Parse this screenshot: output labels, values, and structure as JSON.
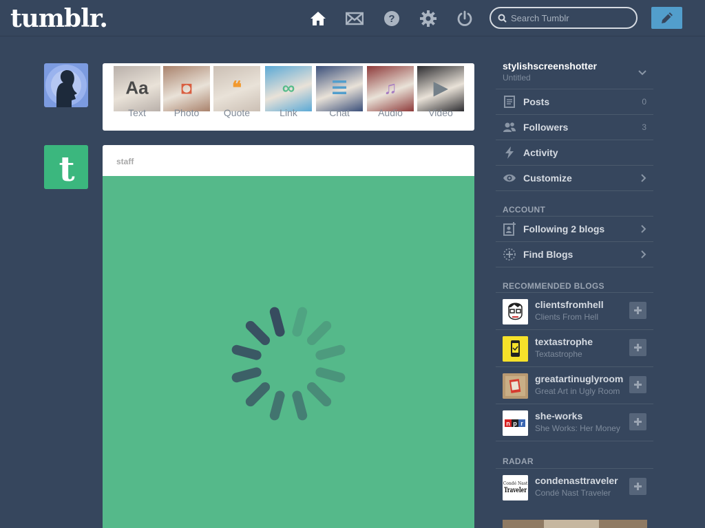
{
  "header": {
    "logo": "tumblr.",
    "search_placeholder": "Search Tumblr",
    "nav_icons": [
      "home-icon",
      "mail-icon",
      "help-icon",
      "gear-icon",
      "power-icon"
    ],
    "compose_icon": "pencil-icon"
  },
  "post_types": [
    {
      "label": "Text",
      "glyph": "Aa",
      "color": "#4a4a4a"
    },
    {
      "label": "Photo",
      "glyph": "◘",
      "color": "#d95e40"
    },
    {
      "label": "Quote",
      "glyph": "❝",
      "color": "#f2992e"
    },
    {
      "label": "Link",
      "glyph": "∞",
      "color": "#56bc8a"
    },
    {
      "label": "Chat",
      "glyph": "☰",
      "color": "#529ecc"
    },
    {
      "label": "Audio",
      "glyph": "♫",
      "color": "#a77dc2"
    },
    {
      "label": "Video",
      "glyph": "▶",
      "color": "#748089"
    }
  ],
  "post": {
    "author": "staff"
  },
  "sidebar": {
    "blog_name": "stylishscreenshotter",
    "blog_subtitle": "Untitled",
    "items": [
      {
        "label": "Posts",
        "count": "0",
        "icon": "posts-icon"
      },
      {
        "label": "Followers",
        "count": "3",
        "icon": "followers-icon"
      },
      {
        "label": "Activity",
        "count": "",
        "icon": "activity-icon"
      },
      {
        "label": "Customize",
        "count": "",
        "icon": "eye-icon"
      }
    ],
    "account_title": "ACCOUNT",
    "account_items": [
      {
        "label": "Following 2 blogs",
        "icon": "following-icon"
      },
      {
        "label": "Find Blogs",
        "icon": "find-blogs-icon"
      }
    ],
    "recommended_title": "RECOMMENDED BLOGS",
    "recommended": [
      {
        "name": "clientsfromhell",
        "title": "Clients From Hell",
        "avatar_color": "#ffffff"
      },
      {
        "name": "textastrophe",
        "title": "Textastrophe",
        "avatar_color": "#f5e12a"
      },
      {
        "name": "greatartinuglyroom",
        "title": "Great Art in Ugly Room",
        "avatar_color": "#b99a72"
      },
      {
        "name": "she-works",
        "title": "She Works: Her Money",
        "avatar_color": "#ffffff"
      }
    ],
    "radar_title": "RADAR",
    "radar": [
      {
        "name": "condenasttraveler",
        "title": "Condé Nast Traveler",
        "avatar_color": "#ffffff"
      }
    ]
  }
}
